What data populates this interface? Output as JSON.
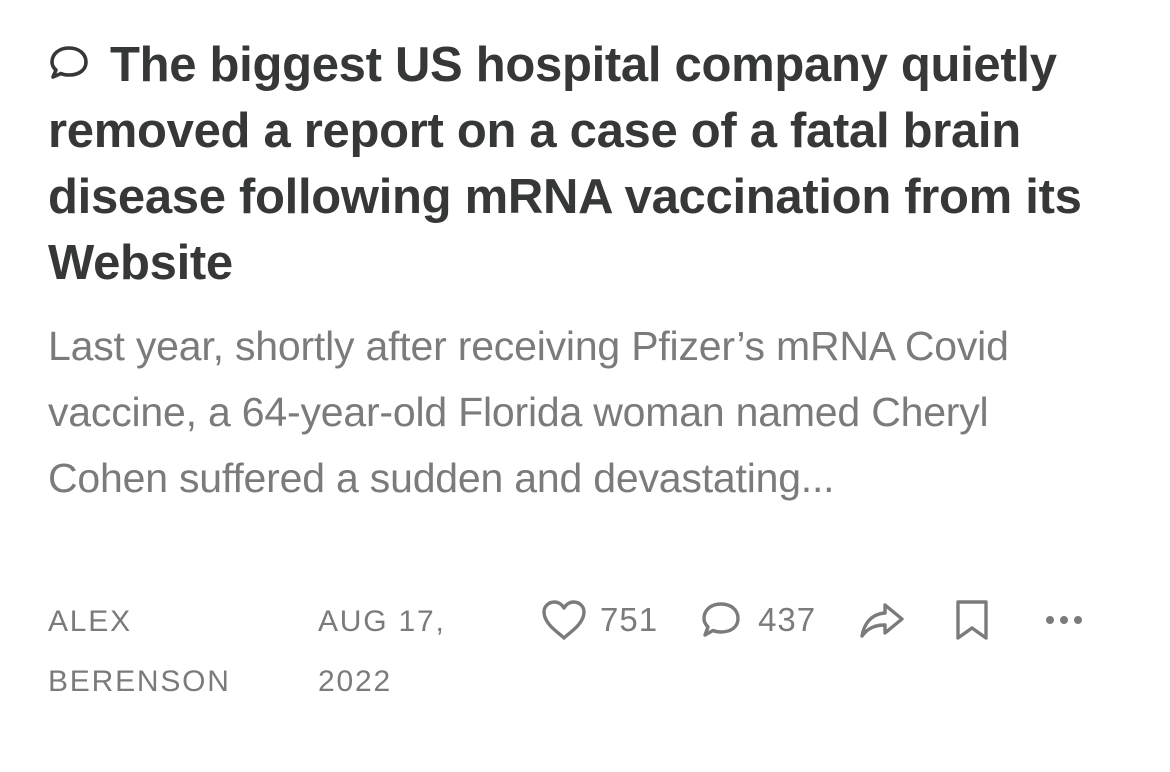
{
  "post": {
    "title": "The biggest US hospital company quietly removed a report on a case of a fatal brain disease following mRNA vaccination from its Website",
    "subtitle": "Last year, shortly after receiving Pfizer’s mRNA Covid vaccine, a 64-year-old Florida woman named Cheryl Cohen suffered a sudden and devastating...",
    "author_line1": "ALEX",
    "author_line2": "BERENSON",
    "date_line1": "AUG 17,",
    "date_line2": "2022",
    "likes": "751",
    "comments": "437"
  },
  "icons": {
    "title_icon": "comment-bubble-icon",
    "like": "heart-icon",
    "comment": "comment-icon",
    "share": "share-arrow-icon",
    "save": "bookmark-icon",
    "more": "more-horizontal-icon"
  },
  "colors": {
    "title": "#363737",
    "muted": "#7b7b7b",
    "background": "#ffffff"
  }
}
